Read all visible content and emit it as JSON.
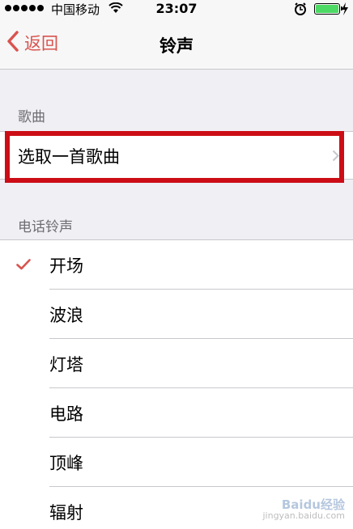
{
  "status_bar": {
    "carrier": "中国移动",
    "time": "23:07"
  },
  "nav": {
    "back_label": "返回",
    "title": "铃声"
  },
  "songs_section": {
    "header": "歌曲",
    "pick_song_label": "选取一首歌曲"
  },
  "ringtones_section": {
    "header": "电话铃声",
    "items": [
      {
        "label": "开场",
        "selected": true
      },
      {
        "label": "波浪",
        "selected": false
      },
      {
        "label": "灯塔",
        "selected": false
      },
      {
        "label": "电路",
        "selected": false
      },
      {
        "label": "顶峰",
        "selected": false
      },
      {
        "label": "辐射",
        "selected": false
      }
    ]
  },
  "watermark": {
    "line1": "Baidu经验",
    "line2": "jingyan.baidu.com"
  },
  "colors": {
    "accent": "#d9534f",
    "highlight_box": "#cc0d16",
    "battery": "#4cd964",
    "background": "#efeff4"
  }
}
